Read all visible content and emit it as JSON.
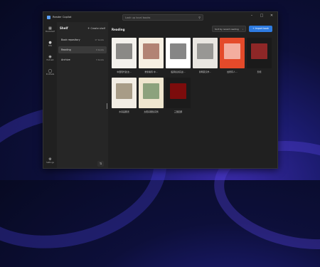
{
  "app": {
    "title": "Reader Copilot"
  },
  "search": {
    "placeholder": "Look up local books"
  },
  "rail": [
    {
      "icon": "bookshelf-icon",
      "label": "Bookshelf"
    },
    {
      "icon": "rss-icon",
      "label": "RSS"
    },
    {
      "icon": "podcast-icon",
      "label": "Podcast"
    },
    {
      "icon": "headphones-icon",
      "label": "Podcasts"
    }
  ],
  "rail_bottom": {
    "icon": "gear-icon",
    "label": "Settings"
  },
  "shelf": {
    "title": "Shelf",
    "create_label": "Create shelf",
    "items": [
      {
        "name": "Book repository",
        "count": "17 books",
        "active": false
      },
      {
        "name": "Reading",
        "count": "9 books",
        "active": true
      },
      {
        "name": "Archive",
        "count": "3 books",
        "active": false
      }
    ]
  },
  "main": {
    "title": "Reading",
    "sort_label": "Sort by recent reading",
    "import_label": "+ Import book"
  },
  "books": [
    {
      "title": "中国现代政治…",
      "bg": "#f3f1ec",
      "fg": "#333"
    },
    {
      "title": "重新看待 中…",
      "bg": "#f6efe2",
      "fg": "#7a2a1a"
    },
    {
      "title": "股票投资实战…",
      "bg": "#ffffff",
      "fg": "#222"
    },
    {
      "title": "简明英汉学…",
      "bg": "#e9e6e1",
      "fg": "#555"
    },
    {
      "title": "给所有人…",
      "bg": "#e44a2a",
      "fg": "#fff"
    },
    {
      "title": "影视",
      "bg": "#1a1a1a",
      "fg": "#e33"
    },
    {
      "title": "水墨画图谱",
      "bg": "#f2ede4",
      "fg": "#6b5a3a"
    },
    {
      "title": "太阳系图鉴实例",
      "bg": "#efe6cf",
      "fg": "#3a6a3a"
    },
    {
      "title": "三国四部",
      "bg": "#1b1b1b",
      "fg": "#c00"
    }
  ]
}
